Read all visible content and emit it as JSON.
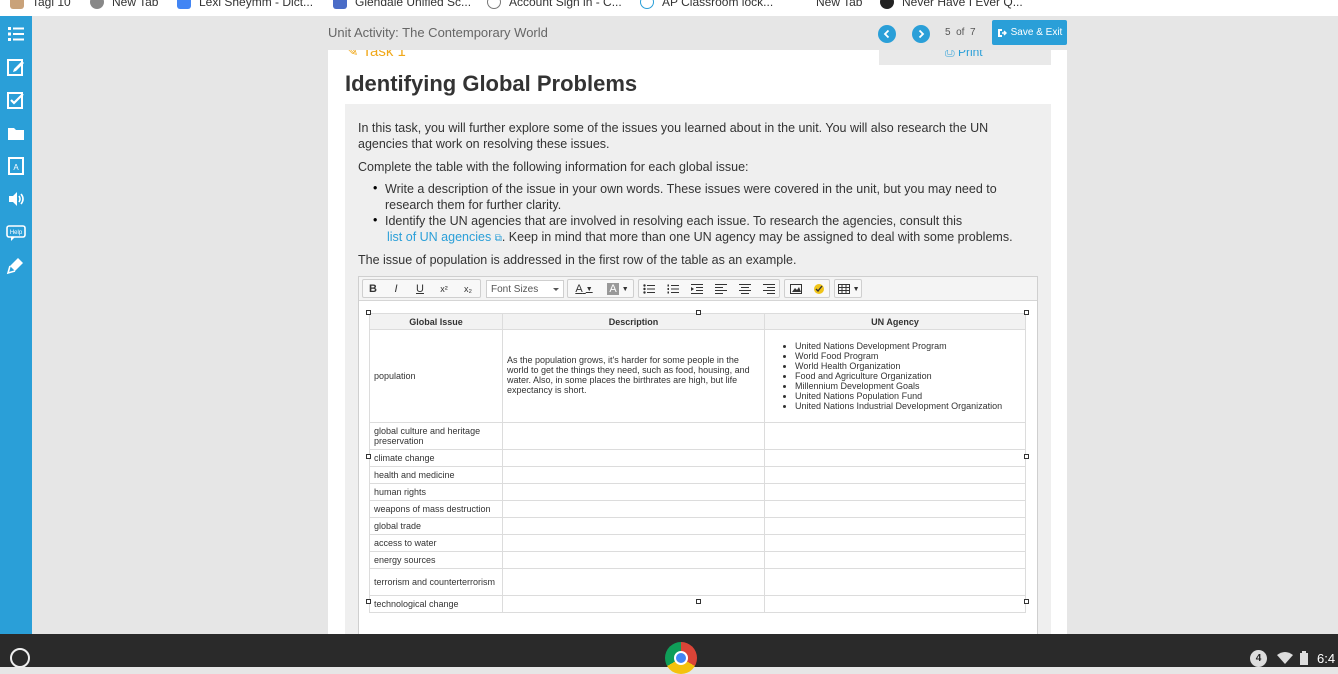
{
  "browser": {
    "bookmarks": [
      {
        "label": "Tagi 10",
        "icon": "folder-icon"
      },
      {
        "label": "New Tab",
        "icon": "globe-icon"
      },
      {
        "label": "Lexi Sheymm - Dict...",
        "icon": "docs-icon"
      },
      {
        "label": "Glendale Unified Sc...",
        "icon": "school-icon"
      },
      {
        "label": "Account Sign in - C...",
        "icon": "shield-icon"
      },
      {
        "label": "AP Classroom lock...",
        "icon": "shield-icon"
      },
      {
        "label": "New Tab",
        "icon": "page-icon"
      },
      {
        "label": "Never Have I Ever Q...",
        "icon": "media-icon"
      }
    ]
  },
  "header": {
    "title": "Unit Activity: The Contemporary World",
    "page_current": "5",
    "page_of": "of",
    "page_total": "7",
    "save_exit_label": "Save & Exit"
  },
  "main": {
    "task_label": "Task 1",
    "print_label": "Print",
    "title": "Identifying Global Problems",
    "intro": "In this task, you will further explore some of the issues you learned about in the unit. You will also research the UN agencies that work on resolving these issues.",
    "instructions": "Complete the table with the following information for each global issue:",
    "bullet1": "Write a description of the issue in your own words. These issues were covered in the unit, but you may need to research them for further clarity.",
    "bullet2_pre": "Identify the UN agencies that are involved in resolving each issue. To research the agencies, consult this",
    "bullet2_link": "list of UN agencies",
    "bullet2_post": ". Keep in mind that more than one UN agency may be assigned to deal with some problems.",
    "example_note": "The issue of population is addressed in the first row of the table as an example."
  },
  "editor": {
    "font_sizes_label": "Font Sizes",
    "toolbar_bold": "B",
    "toolbar_italic": "I",
    "toolbar_underline": "U",
    "toolbar_superscript": "x²",
    "toolbar_subscript": "x₂",
    "toolbar_font_color": "A",
    "toolbar_bg_color": "A"
  },
  "table": {
    "headers": [
      "Global Issue",
      "Description",
      "UN Agency"
    ],
    "rows": [
      {
        "issue": "population",
        "description": "As the population grows, it's harder for some people in the world to get the things they need, such as food, housing, and water. Also, in some places the birthrates are high, but life expectancy is short.",
        "agencies": [
          "United Nations Development Program",
          "World Food Program",
          "World Health Organization",
          "Food and Agriculture Organization",
          "Millennium Development Goals",
          "United Nations Population Fund",
          "United Nations Industrial Development Organization"
        ]
      },
      {
        "issue": "global culture and heritage preservation",
        "description": "",
        "agencies": []
      },
      {
        "issue": "climate change",
        "description": "",
        "agencies": []
      },
      {
        "issue": "health and medicine",
        "description": "",
        "agencies": []
      },
      {
        "issue": "human rights",
        "description": "",
        "agencies": []
      },
      {
        "issue": "weapons of mass destruction",
        "description": "",
        "agencies": []
      },
      {
        "issue": "global trade",
        "description": "",
        "agencies": []
      },
      {
        "issue": "access to water",
        "description": "",
        "agencies": []
      },
      {
        "issue": "energy sources",
        "description": "",
        "agencies": []
      },
      {
        "issue": "terrorism and counterterrorism",
        "description": "",
        "agencies": []
      },
      {
        "issue": "technological change",
        "description": "",
        "agencies": []
      }
    ]
  },
  "taskbar": {
    "tray_badge": "4",
    "time": "6:4"
  },
  "colors": {
    "accent": "#2a9fd8",
    "task_orange": "#f0a81a",
    "taskbar": "#2a2a2a"
  }
}
